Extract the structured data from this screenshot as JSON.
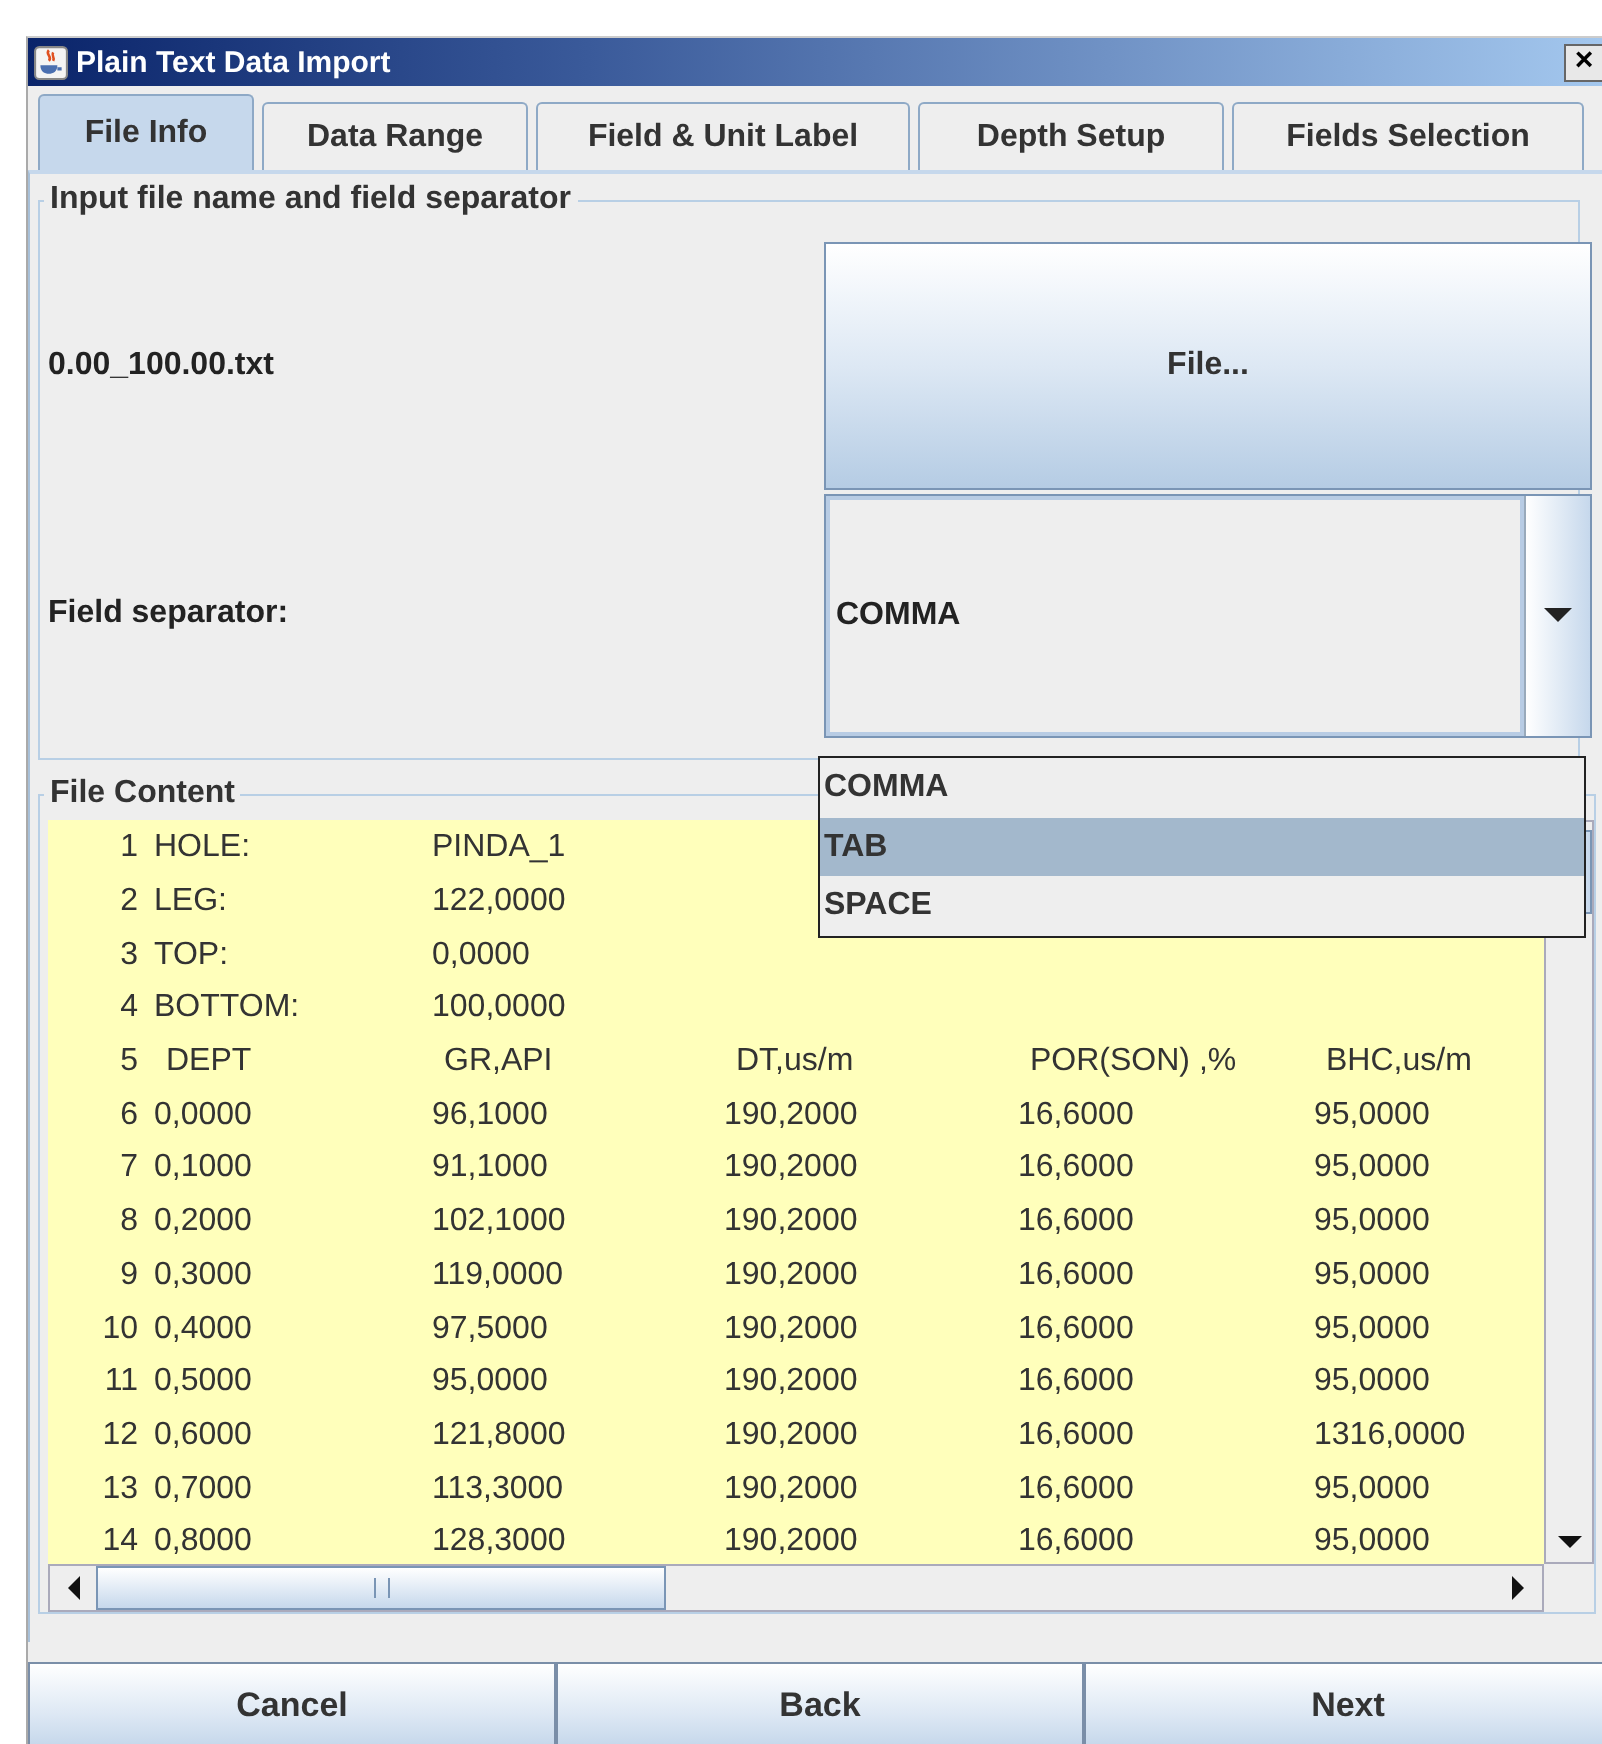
{
  "window": {
    "title": "Plain Text Data Import",
    "close": "×"
  },
  "tabs": [
    {
      "label": "File Info",
      "selected": true
    },
    {
      "label": "Data Range",
      "selected": false
    },
    {
      "label": "Field & Unit Label",
      "selected": false
    },
    {
      "label": "Depth Setup",
      "selected": false
    },
    {
      "label": "Fields Selection",
      "selected": false
    }
  ],
  "input_group": {
    "title": "Input file name and field separator",
    "file_name": "0.00_100.00.txt",
    "file_button": "File...",
    "separator_label": "Field separator:",
    "separator": {
      "value": "COMMA",
      "open": true,
      "options": [
        {
          "label": "COMMA",
          "highlighted": false
        },
        {
          "label": "TAB",
          "highlighted": true
        },
        {
          "label": "SPACE",
          "highlighted": false
        }
      ]
    }
  },
  "file_content": {
    "title": "File Content",
    "lines": [
      {
        "kind": "meta",
        "number": "1",
        "cells": [
          "HOLE:",
          "PINDA_1"
        ]
      },
      {
        "kind": "meta",
        "number": "2",
        "cells": [
          "LEG:",
          "122,0000"
        ]
      },
      {
        "kind": "meta",
        "number": "3",
        "cells": [
          "TOP:",
          "0,0000"
        ]
      },
      {
        "kind": "meta",
        "number": "4",
        "cells": [
          "BOTTOM:",
          "100,0000"
        ]
      },
      {
        "kind": "header",
        "number": "5",
        "cells": [
          "DEPT",
          "GR,API",
          "DT,us/m",
          "POR(SON) ,%",
          "BHC,us/m"
        ]
      },
      {
        "kind": "data",
        "number": "6",
        "cells": [
          "0,0000",
          "96,1000",
          "190,2000",
          "16,6000",
          "95,0000"
        ]
      },
      {
        "kind": "data",
        "number": "7",
        "cells": [
          "0,1000",
          "91,1000",
          "190,2000",
          "16,6000",
          "95,0000"
        ]
      },
      {
        "kind": "data",
        "number": "8",
        "cells": [
          "0,2000",
          "102,1000",
          "190,2000",
          "16,6000",
          "95,0000"
        ]
      },
      {
        "kind": "data",
        "number": "9",
        "cells": [
          "0,3000",
          "119,0000",
          "190,2000",
          "16,6000",
          "95,0000"
        ]
      },
      {
        "kind": "data",
        "number": "10",
        "cells": [
          "0,4000",
          "97,5000",
          "190,2000",
          "16,6000",
          "95,0000"
        ]
      },
      {
        "kind": "data",
        "number": "11",
        "cells": [
          "0,5000",
          "95,0000",
          "190,2000",
          "16,6000",
          "95,0000"
        ]
      },
      {
        "kind": "data",
        "number": "12",
        "cells": [
          "0,6000",
          "121,8000",
          "190,2000",
          "16,6000",
          "1316,0000"
        ]
      },
      {
        "kind": "data",
        "number": "13",
        "cells": [
          "0,7000",
          "113,3000",
          "190,2000",
          "16,6000",
          "95,0000"
        ]
      },
      {
        "kind": "data",
        "number": "14",
        "cells": [
          "0,8000",
          "128,3000",
          "190,2000",
          "16,6000",
          "95,0000"
        ]
      }
    ]
  },
  "buttons": [
    "Cancel",
    "Back",
    "Next"
  ]
}
